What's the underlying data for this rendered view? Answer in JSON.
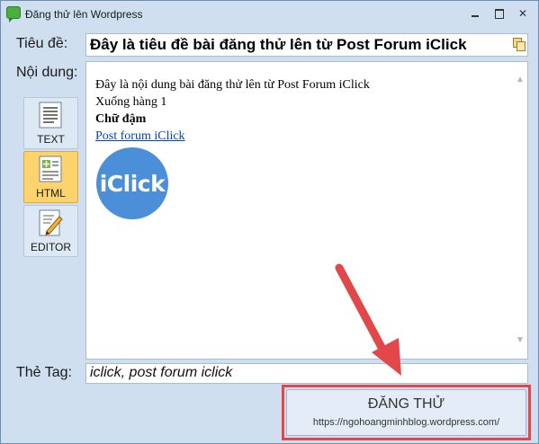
{
  "window": {
    "title": "Đăng thử lên Wordpress"
  },
  "form": {
    "title_label": "Tiêu đề:",
    "title_value": "Đây là tiêu đề bài đăng thử lên từ Post Forum iClick",
    "content_label": "Nội dung:",
    "tag_label": "Thẻ Tag:",
    "tag_value": "iclick, post forum iclick"
  },
  "modes": [
    {
      "label": "TEXT",
      "icon": "text-document-icon",
      "active": false
    },
    {
      "label": "HTML",
      "icon": "html-document-icon",
      "active": true
    },
    {
      "label": "EDITOR",
      "icon": "editor-pen-icon",
      "active": false
    }
  ],
  "content": {
    "line1": "Đây là nội dung bài đăng thử lên từ Post Forum iClick",
    "line2": "Xuống hàng 1",
    "bold": "Chữ đậm",
    "link": "Post forum iClick",
    "logo_text": "iClick"
  },
  "submit": {
    "label": "ĐĂNG THỬ",
    "url": "https://ngohoangminhblog.wordpress.com/"
  },
  "colors": {
    "window_bg": "#cfdff0",
    "active_mode": "#fbd46e",
    "annotation": "#e2474a",
    "logo": "#4a8fd8"
  }
}
